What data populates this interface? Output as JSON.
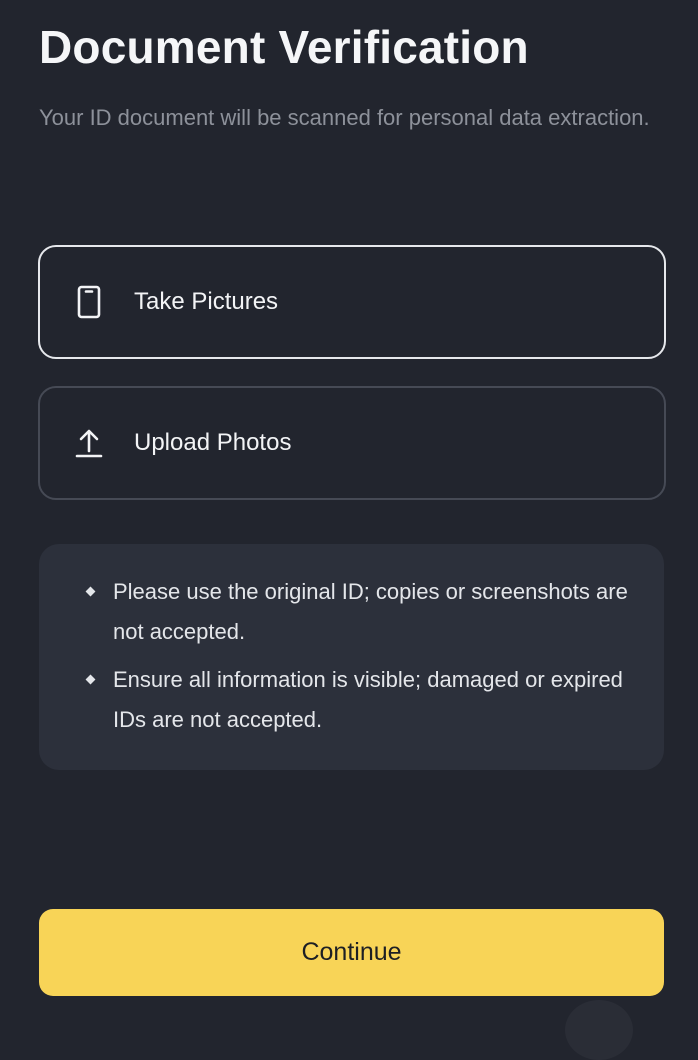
{
  "header": {
    "title": "Document Verification",
    "subtitle": "Your ID document will be scanned for personal data extraction."
  },
  "options": [
    {
      "label": "Take Pictures",
      "icon": "phone-icon",
      "selected": true
    },
    {
      "label": "Upload Photos",
      "icon": "upload-icon",
      "selected": false
    }
  ],
  "info": {
    "items": [
      "Please use the original ID; copies or screenshots are not accepted.",
      "Ensure all information is visible; damaged or expired IDs are not accepted."
    ]
  },
  "footer": {
    "continue_label": "Continue"
  },
  "colors": {
    "background": "#22252e",
    "panel": "#2c303b",
    "accent": "#f8d457",
    "selected_border": "#e6e8ec",
    "unselected_border": "#464a55"
  }
}
